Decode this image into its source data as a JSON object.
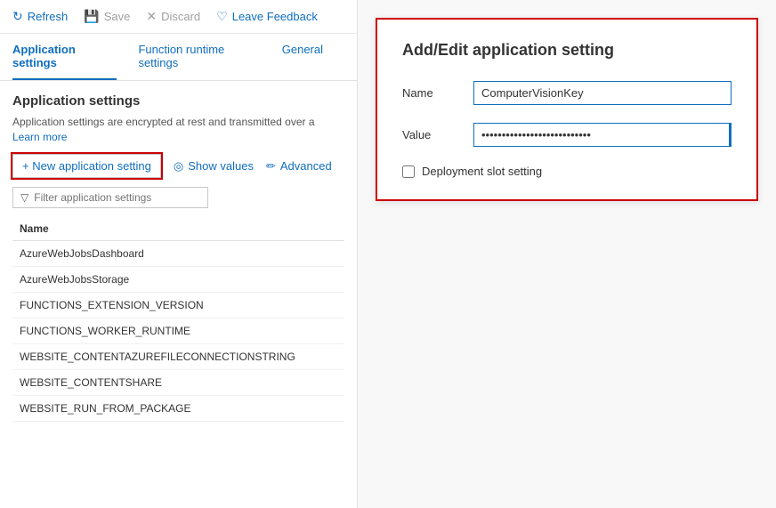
{
  "toolbar": {
    "refresh_label": "Refresh",
    "save_label": "Save",
    "discard_label": "Discard",
    "feedback_label": "Leave Feedback"
  },
  "tabs": {
    "items": [
      {
        "label": "Application settings",
        "active": true
      },
      {
        "label": "Function runtime settings",
        "active": false
      },
      {
        "label": "General",
        "active": false
      }
    ]
  },
  "main": {
    "section_title": "Application settings",
    "section_desc": "Application settings are encrypted at rest and transmitted over a",
    "learn_more": "Learn more"
  },
  "actions": {
    "new_setting": "+ New application setting",
    "show_values": "Show values",
    "advanced": "Advanced"
  },
  "filter": {
    "placeholder": "Filter application settings"
  },
  "table": {
    "column_name": "Name",
    "rows": [
      {
        "name": "AzureWebJobsDashboard"
      },
      {
        "name": "AzureWebJobsStorage"
      },
      {
        "name": "FUNCTIONS_EXTENSION_VERSION"
      },
      {
        "name": "FUNCTIONS_WORKER_RUNTIME"
      },
      {
        "name": "WEBSITE_CONTENTAZUREFILECONNECTIONSTRING"
      },
      {
        "name": "WEBSITE_CONTENTSHARE"
      },
      {
        "name": "WEBSITE_RUN_FROM_PACKAGE"
      }
    ]
  },
  "dialog": {
    "title": "Add/Edit application setting",
    "name_label": "Name",
    "name_value": "ComputerVisionKey",
    "value_label": "Value",
    "value_placeholder": "***************************",
    "checkbox_label": "Deployment slot setting"
  }
}
